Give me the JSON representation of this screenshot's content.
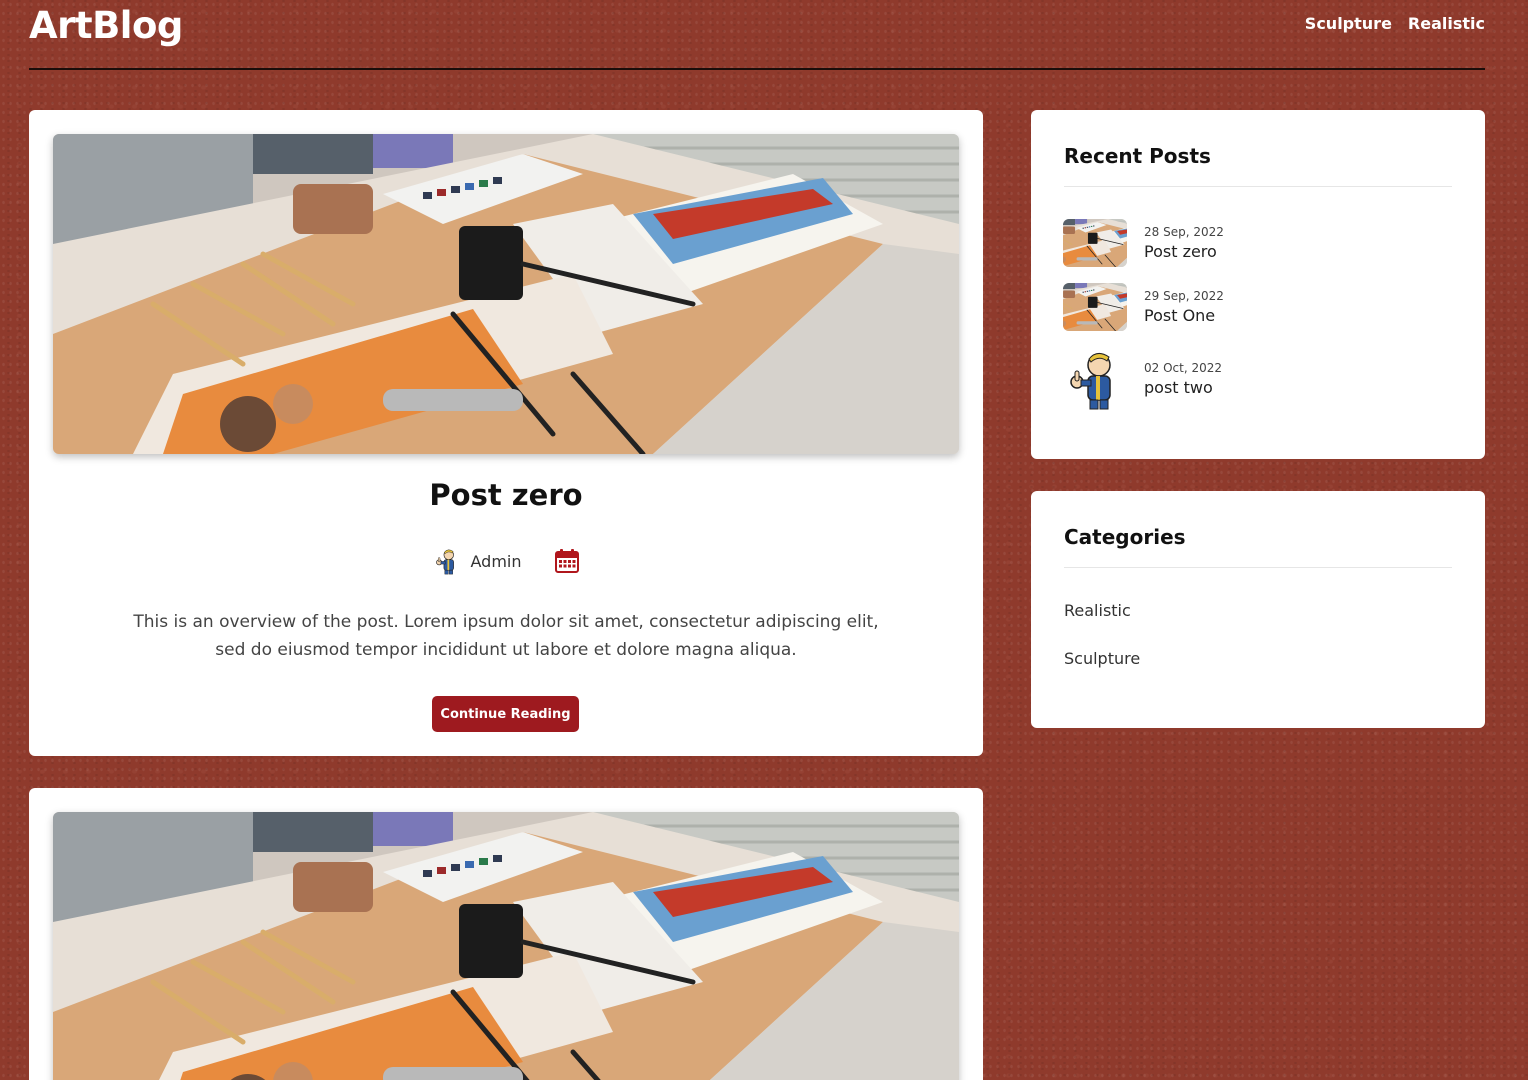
{
  "site": {
    "logo": "ArtBlog"
  },
  "nav": {
    "items": [
      {
        "label": "Sculpture"
      },
      {
        "label": "Realistic"
      }
    ]
  },
  "posts": [
    {
      "title": "Post zero",
      "author": "Admin",
      "excerpt": "This is an overview of the post. Lorem ipsum dolor sit amet, consectetur adipiscing elit, sed do eiusmod tempor incididunt ut labore et dolore magna aliqua.",
      "button_label": "Continue Reading",
      "image": "art-studio-desk-photo",
      "author_icon": "mascot-avatar-icon",
      "date_icon": "calendar-icon"
    },
    {
      "image": "art-studio-desk-photo"
    }
  ],
  "sidebar": {
    "recent": {
      "title": "Recent Posts",
      "items": [
        {
          "date": "28 Sep, 2022",
          "title": "Post zero",
          "thumb": "art-studio-desk-photo"
        },
        {
          "date": "29 Sep, 2022",
          "title": "Post One",
          "thumb": "art-studio-desk-photo"
        },
        {
          "date": "02 Oct, 2022",
          "title": "post two",
          "thumb": "mascot-thumbs-up"
        }
      ]
    },
    "categories": {
      "title": "Categories",
      "items": [
        {
          "label": "Realistic"
        },
        {
          "label": "Sculpture"
        }
      ]
    }
  },
  "colors": {
    "accent": "#9e1a1f",
    "background": "#8f3a2c"
  }
}
